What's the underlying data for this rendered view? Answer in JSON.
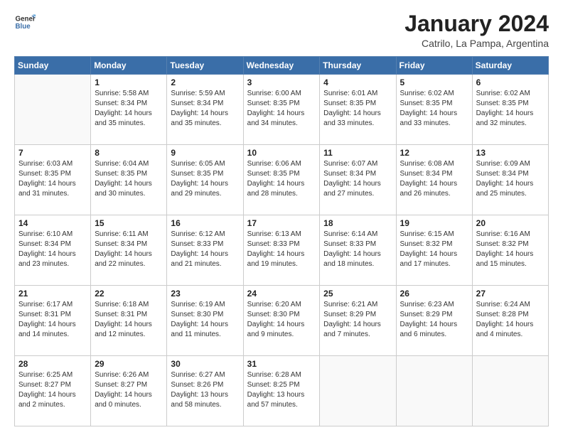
{
  "logo": {
    "line1": "General",
    "line2": "Blue"
  },
  "title": "January 2024",
  "subtitle": "Catrilo, La Pampa, Argentina",
  "weekdays": [
    "Sunday",
    "Monday",
    "Tuesday",
    "Wednesday",
    "Thursday",
    "Friday",
    "Saturday"
  ],
  "weeks": [
    [
      {
        "day": "",
        "info": ""
      },
      {
        "day": "1",
        "info": "Sunrise: 5:58 AM\nSunset: 8:34 PM\nDaylight: 14 hours\nand 35 minutes."
      },
      {
        "day": "2",
        "info": "Sunrise: 5:59 AM\nSunset: 8:34 PM\nDaylight: 14 hours\nand 35 minutes."
      },
      {
        "day": "3",
        "info": "Sunrise: 6:00 AM\nSunset: 8:35 PM\nDaylight: 14 hours\nand 34 minutes."
      },
      {
        "day": "4",
        "info": "Sunrise: 6:01 AM\nSunset: 8:35 PM\nDaylight: 14 hours\nand 33 minutes."
      },
      {
        "day": "5",
        "info": "Sunrise: 6:02 AM\nSunset: 8:35 PM\nDaylight: 14 hours\nand 33 minutes."
      },
      {
        "day": "6",
        "info": "Sunrise: 6:02 AM\nSunset: 8:35 PM\nDaylight: 14 hours\nand 32 minutes."
      }
    ],
    [
      {
        "day": "7",
        "info": "Sunrise: 6:03 AM\nSunset: 8:35 PM\nDaylight: 14 hours\nand 31 minutes."
      },
      {
        "day": "8",
        "info": "Sunrise: 6:04 AM\nSunset: 8:35 PM\nDaylight: 14 hours\nand 30 minutes."
      },
      {
        "day": "9",
        "info": "Sunrise: 6:05 AM\nSunset: 8:35 PM\nDaylight: 14 hours\nand 29 minutes."
      },
      {
        "day": "10",
        "info": "Sunrise: 6:06 AM\nSunset: 8:35 PM\nDaylight: 14 hours\nand 28 minutes."
      },
      {
        "day": "11",
        "info": "Sunrise: 6:07 AM\nSunset: 8:34 PM\nDaylight: 14 hours\nand 27 minutes."
      },
      {
        "day": "12",
        "info": "Sunrise: 6:08 AM\nSunset: 8:34 PM\nDaylight: 14 hours\nand 26 minutes."
      },
      {
        "day": "13",
        "info": "Sunrise: 6:09 AM\nSunset: 8:34 PM\nDaylight: 14 hours\nand 25 minutes."
      }
    ],
    [
      {
        "day": "14",
        "info": "Sunrise: 6:10 AM\nSunset: 8:34 PM\nDaylight: 14 hours\nand 23 minutes."
      },
      {
        "day": "15",
        "info": "Sunrise: 6:11 AM\nSunset: 8:34 PM\nDaylight: 14 hours\nand 22 minutes."
      },
      {
        "day": "16",
        "info": "Sunrise: 6:12 AM\nSunset: 8:33 PM\nDaylight: 14 hours\nand 21 minutes."
      },
      {
        "day": "17",
        "info": "Sunrise: 6:13 AM\nSunset: 8:33 PM\nDaylight: 14 hours\nand 19 minutes."
      },
      {
        "day": "18",
        "info": "Sunrise: 6:14 AM\nSunset: 8:33 PM\nDaylight: 14 hours\nand 18 minutes."
      },
      {
        "day": "19",
        "info": "Sunrise: 6:15 AM\nSunset: 8:32 PM\nDaylight: 14 hours\nand 17 minutes."
      },
      {
        "day": "20",
        "info": "Sunrise: 6:16 AM\nSunset: 8:32 PM\nDaylight: 14 hours\nand 15 minutes."
      }
    ],
    [
      {
        "day": "21",
        "info": "Sunrise: 6:17 AM\nSunset: 8:31 PM\nDaylight: 14 hours\nand 14 minutes."
      },
      {
        "day": "22",
        "info": "Sunrise: 6:18 AM\nSunset: 8:31 PM\nDaylight: 14 hours\nand 12 minutes."
      },
      {
        "day": "23",
        "info": "Sunrise: 6:19 AM\nSunset: 8:30 PM\nDaylight: 14 hours\nand 11 minutes."
      },
      {
        "day": "24",
        "info": "Sunrise: 6:20 AM\nSunset: 8:30 PM\nDaylight: 14 hours\nand 9 minutes."
      },
      {
        "day": "25",
        "info": "Sunrise: 6:21 AM\nSunset: 8:29 PM\nDaylight: 14 hours\nand 7 minutes."
      },
      {
        "day": "26",
        "info": "Sunrise: 6:23 AM\nSunset: 8:29 PM\nDaylight: 14 hours\nand 6 minutes."
      },
      {
        "day": "27",
        "info": "Sunrise: 6:24 AM\nSunset: 8:28 PM\nDaylight: 14 hours\nand 4 minutes."
      }
    ],
    [
      {
        "day": "28",
        "info": "Sunrise: 6:25 AM\nSunset: 8:27 PM\nDaylight: 14 hours\nand 2 minutes."
      },
      {
        "day": "29",
        "info": "Sunrise: 6:26 AM\nSunset: 8:27 PM\nDaylight: 14 hours\nand 0 minutes."
      },
      {
        "day": "30",
        "info": "Sunrise: 6:27 AM\nSunset: 8:26 PM\nDaylight: 13 hours\nand 58 minutes."
      },
      {
        "day": "31",
        "info": "Sunrise: 6:28 AM\nSunset: 8:25 PM\nDaylight: 13 hours\nand 57 minutes."
      },
      {
        "day": "",
        "info": ""
      },
      {
        "day": "",
        "info": ""
      },
      {
        "day": "",
        "info": ""
      }
    ]
  ]
}
